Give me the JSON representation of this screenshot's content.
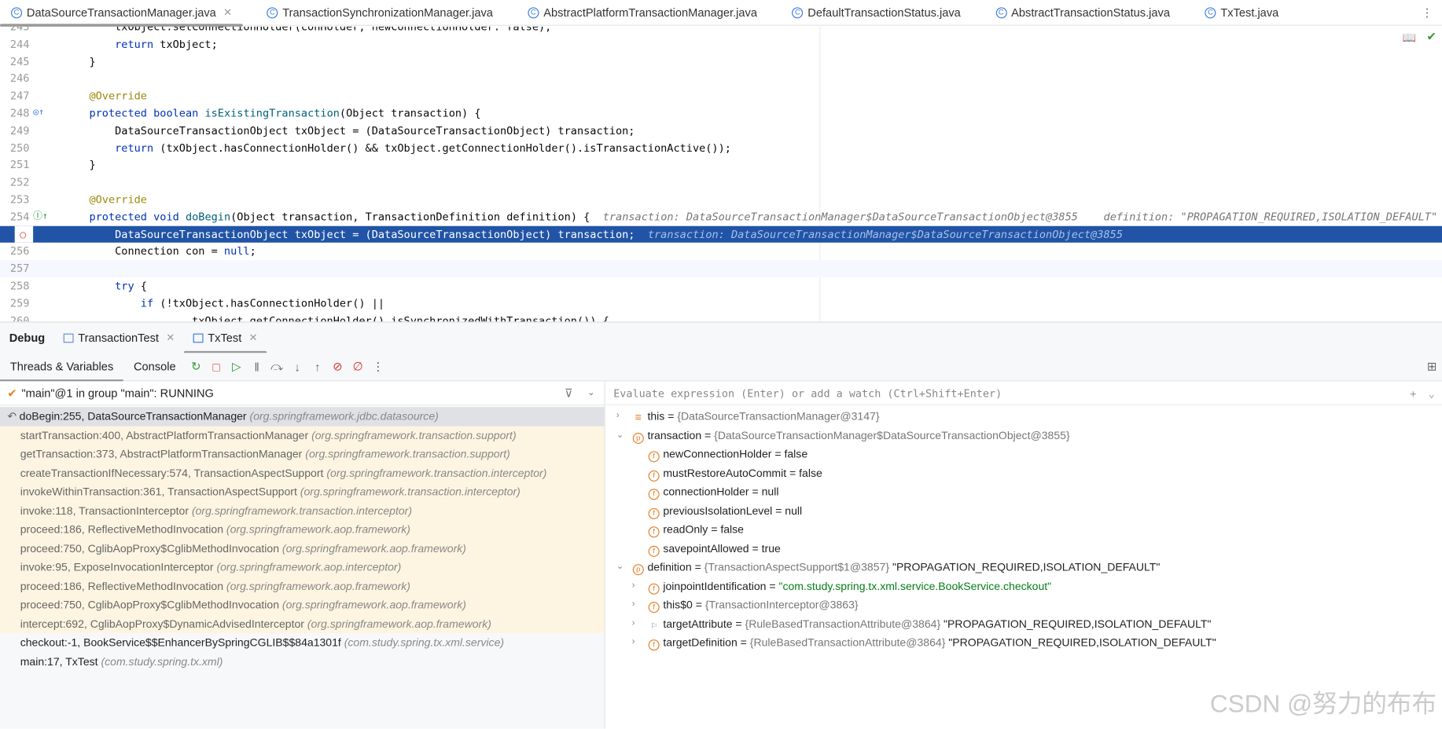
{
  "tabs": [
    {
      "label": "DataSourceTransactionManager.java",
      "active": true
    },
    {
      "label": "TransactionSynchronizationManager.java"
    },
    {
      "label": "AbstractPlatformTransactionManager.java"
    },
    {
      "label": "DefaultTransactionStatus.java"
    },
    {
      "label": "AbstractTransactionStatus.java"
    },
    {
      "label": "TxTest.java"
    }
  ],
  "editor": {
    "lines": [
      {
        "n": "243",
        "t": "        txObject.setConnectionHolder(conHolder, newConnectionHolder: false);"
      },
      {
        "n": "244",
        "t": "        return txObject;"
      },
      {
        "n": "245",
        "t": "    }"
      },
      {
        "n": "246",
        "t": ""
      },
      {
        "n": "247",
        "t": "    @Override"
      },
      {
        "n": "248",
        "t": "    protected boolean isExistingTransaction(Object transaction) {"
      },
      {
        "n": "249",
        "t": "        DataSourceTransactionObject txObject = (DataSourceTransactionObject) transaction;"
      },
      {
        "n": "250",
        "t": "        return (txObject.hasConnectionHolder() && txObject.getConnectionHolder().isTransactionActive());"
      },
      {
        "n": "251",
        "t": "    }"
      },
      {
        "n": "252",
        "t": ""
      },
      {
        "n": "253",
        "t": "    @Override"
      },
      {
        "n": "254",
        "t": "    protected void doBegin(Object transaction, TransactionDefinition definition) {",
        "hint": "transaction: DataSourceTransactionManager$DataSourceTransactionObject@3855    definition: \"PROPAGATION_REQUIRED,ISOLATION_DEFAULT\""
      },
      {
        "n": "",
        "t": "        DataSourceTransactionObject txObject = (DataSourceTransactionObject) transaction;",
        "hint": "transaction: DataSourceTransactionManager$DataSourceTransactionObject@3855",
        "selected": true
      },
      {
        "n": "256",
        "t": "        Connection con = null;"
      },
      {
        "n": "257",
        "t": ""
      },
      {
        "n": "258",
        "t": "        try {"
      },
      {
        "n": "259",
        "t": "            if (!txObject.hasConnectionHolder() ||"
      },
      {
        "n": "260",
        "t": "                    txObject.getConnectionHolder().isSynchronizedWithTransaction()) {"
      }
    ]
  },
  "debug": {
    "title": "Debug",
    "sessions": [
      {
        "label": "TransactionTest"
      },
      {
        "label": "TxTest",
        "active": true
      }
    ],
    "tabs": [
      "Threads & Variables",
      "Console"
    ],
    "thread": "\"main\"@1 in group \"main\": RUNNING",
    "eval_placeholder": "Evaluate expression (Enter) or add a watch (Ctrl+Shift+Enter)",
    "frames": [
      {
        "m": "doBegin:255, DataSourceTransactionManager",
        "p": "(org.springframework.jdbc.datasource)",
        "kind": "cur"
      },
      {
        "m": "startTransaction:400, AbstractPlatformTransactionManager",
        "p": "(org.springframework.transaction.support)",
        "kind": "lib"
      },
      {
        "m": "getTransaction:373, AbstractPlatformTransactionManager",
        "p": "(org.springframework.transaction.support)",
        "kind": "lib"
      },
      {
        "m": "createTransactionIfNecessary:574, TransactionAspectSupport",
        "p": "(org.springframework.transaction.interceptor)",
        "kind": "lib"
      },
      {
        "m": "invokeWithinTransaction:361, TransactionAspectSupport",
        "p": "(org.springframework.transaction.interceptor)",
        "kind": "lib"
      },
      {
        "m": "invoke:118, TransactionInterceptor",
        "p": "(org.springframework.transaction.interceptor)",
        "kind": "lib"
      },
      {
        "m": "proceed:186, ReflectiveMethodInvocation",
        "p": "(org.springframework.aop.framework)",
        "kind": "lib"
      },
      {
        "m": "proceed:750, CglibAopProxy$CglibMethodInvocation",
        "p": "(org.springframework.aop.framework)",
        "kind": "lib"
      },
      {
        "m": "invoke:95, ExposeInvocationInterceptor",
        "p": "(org.springframework.aop.interceptor)",
        "kind": "lib"
      },
      {
        "m": "proceed:186, ReflectiveMethodInvocation",
        "p": "(org.springframework.aop.framework)",
        "kind": "lib"
      },
      {
        "m": "proceed:750, CglibAopProxy$CglibMethodInvocation",
        "p": "(org.springframework.aop.framework)",
        "kind": "lib"
      },
      {
        "m": "intercept:692, CglibAopProxy$DynamicAdvisedInterceptor",
        "p": "(org.springframework.aop.framework)",
        "kind": "lib"
      },
      {
        "m": "checkout:-1, BookService$$EnhancerBySpringCGLIB$$84a1301f",
        "p": "(com.study.spring.tx.xml.service)",
        "kind": "user"
      },
      {
        "m": "main:17, TxTest",
        "p": "(com.study.spring.tx.xml)",
        "kind": "user"
      }
    ],
    "variables": [
      {
        "lvl": 0,
        "exp": ">",
        "icon": "≡",
        "name": "this",
        "type": "{DataSourceTransactionManager@3147}",
        "val": ""
      },
      {
        "lvl": 0,
        "exp": "v",
        "icon": "p",
        "name": "transaction",
        "type": "{DataSourceTransactionManager$DataSourceTransactionObject@3855}",
        "val": ""
      },
      {
        "lvl": 1,
        "exp": "",
        "icon": "f",
        "name": "newConnectionHolder",
        "type": "",
        "val": "false"
      },
      {
        "lvl": 1,
        "exp": "",
        "icon": "f",
        "name": "mustRestoreAutoCommit",
        "type": "",
        "val": "false"
      },
      {
        "lvl": 1,
        "exp": "",
        "icon": "f",
        "name": "connectionHolder",
        "type": "",
        "val": "null"
      },
      {
        "lvl": 1,
        "exp": "",
        "icon": "f",
        "name": "previousIsolationLevel",
        "type": "",
        "val": "null"
      },
      {
        "lvl": 1,
        "exp": "",
        "icon": "f",
        "name": "readOnly",
        "type": "",
        "val": "false"
      },
      {
        "lvl": 1,
        "exp": "",
        "icon": "f",
        "name": "savepointAllowed",
        "type": "",
        "val": "true"
      },
      {
        "lvl": 0,
        "exp": "v",
        "icon": "p",
        "name": "definition",
        "type": "{TransactionAspectSupport$1@3857}",
        "val": "\"PROPAGATION_REQUIRED,ISOLATION_DEFAULT\""
      },
      {
        "lvl": 1,
        "exp": ">",
        "icon": "f",
        "name": "joinpointIdentification",
        "type": "",
        "val": "\"com.study.spring.tx.xml.service.BookService.checkout\"",
        "str": true
      },
      {
        "lvl": 1,
        "exp": ">",
        "icon": "f",
        "name": "this$0",
        "type": "{TransactionInterceptor@3863}",
        "val": ""
      },
      {
        "lvl": 1,
        "exp": ">",
        "icon": "⚐",
        "name": "targetAttribute",
        "type": "{RuleBasedTransactionAttribute@3864}",
        "val": "\"PROPAGATION_REQUIRED,ISOLATION_DEFAULT\""
      },
      {
        "lvl": 1,
        "exp": ">",
        "icon": "f",
        "name": "targetDefinition",
        "type": "{RuleBasedTransactionAttribute@3864}",
        "val": "\"PROPAGATION_REQUIRED,ISOLATION_DEFAULT\""
      }
    ]
  },
  "watermark": "CSDN @努力的布布"
}
